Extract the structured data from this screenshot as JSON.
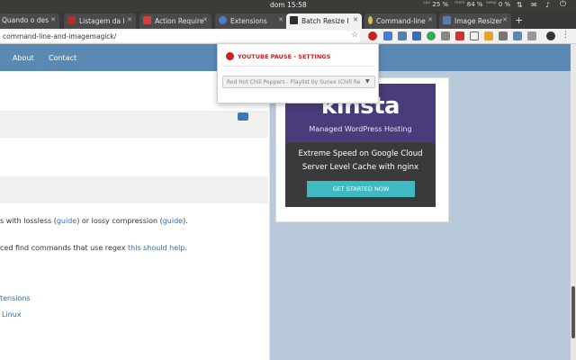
{
  "system": {
    "clock": "dom 15:58",
    "cpu_label": "cpu",
    "cpu_value": "25 %",
    "mem_label": "mem",
    "mem_value": "84 %",
    "swap_label": "swap",
    "swap_value": "0 %"
  },
  "tabs": [
    {
      "label": "Quando o des",
      "color": "#cc3333",
      "active": false
    },
    {
      "label": "Listagem da l",
      "color": "#b03030",
      "active": false
    },
    {
      "label": "Action Require",
      "color": "#d04040",
      "active": false
    },
    {
      "label": "Extensions",
      "color": "#4a7bd0",
      "active": false
    },
    {
      "label": "Batch Resize I",
      "color": "#2d2d2d",
      "active": true
    },
    {
      "label": "Command-line",
      "color": "#e0c040",
      "active": false
    },
    {
      "label": "Image Resizer",
      "color": "#5a7ea8",
      "active": false
    }
  ],
  "address": {
    "url": "command-line-and-imagemagick/"
  },
  "nav": {
    "about": "About",
    "contact": "Contact"
  },
  "content": {
    "line1_pre": "s with lossless (",
    "line1_link1": "guide",
    "line1_mid": ") or lossy compression (",
    "line1_link2": "guide",
    "line1_post": ").",
    "line2_pre": "ced find commands that use regex ",
    "line2_link": "this should help",
    "line2_post": ".",
    "link3": "tensions",
    "link4": "Linux"
  },
  "ad": {
    "logo": "kinsta",
    "subtitle": "Managed WordPress Hosting",
    "line1": "Extreme Speed on Google Cloud",
    "line2": "Server Level Cache with nginx",
    "button": "GET STARTED NOW"
  },
  "popup": {
    "title": "YOUTUBE PAUSE - SETTINGS",
    "select_value": "Red Hot Chili Peppers - Playlist by Sunex (Chill Re"
  },
  "colors": {
    "nav": "#5a8ab4",
    "sidebar": "#b8cad9",
    "ad_bg": "#4a3c7a",
    "ad_button": "#3fbac0",
    "popup_title": "#c21f1f"
  }
}
